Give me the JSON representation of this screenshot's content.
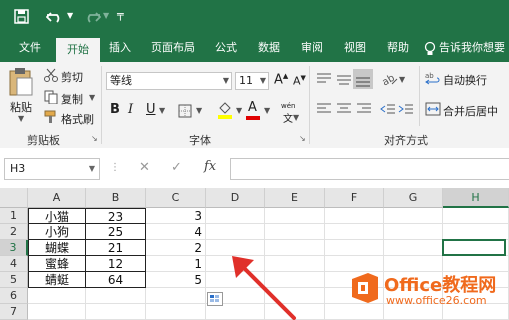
{
  "quick_access": {
    "tell_me": "告诉我你想要"
  },
  "tabs": [
    "文件",
    "开始",
    "插入",
    "页面布局",
    "公式",
    "数据",
    "审阅",
    "视图",
    "帮助"
  ],
  "active_tab": "开始",
  "ribbon": {
    "paste": "粘贴",
    "cut": "剪切",
    "copy": "复制",
    "format_painter": "格式刷",
    "clipboard_group": "剪贴板",
    "font_name": "等线",
    "font_size": "11",
    "font_group": "字体",
    "bold": "B",
    "italic": "I",
    "underline": "U",
    "wrap_text": "自动换行",
    "merge_center": "合并后居中",
    "alignment_group": "对齐方式",
    "grow_font": "A",
    "shrink_font": "A",
    "font_color_letter": "A",
    "phonetic": "wén"
  },
  "formula_bar": {
    "name_box": "H3",
    "fx": "fx",
    "cancel": "✕",
    "enter": "✓",
    "value": ""
  },
  "columns": [
    "A",
    "B",
    "C",
    "D",
    "E",
    "F",
    "G",
    "H"
  ],
  "rows": [
    {
      "num": "1",
      "a": "小猫",
      "b": "23",
      "c": "3"
    },
    {
      "num": "2",
      "a": "小狗",
      "b": "25",
      "c": "4"
    },
    {
      "num": "3",
      "a": "蝴蝶",
      "b": "21",
      "c": "2"
    },
    {
      "num": "4",
      "a": "蜜蜂",
      "b": "12",
      "c": "1"
    },
    {
      "num": "5",
      "a": "蜻蜓",
      "b": "64",
      "c": "5"
    },
    {
      "num": "6",
      "a": "",
      "b": "",
      "c": ""
    },
    {
      "num": "7",
      "a": "",
      "b": "",
      "c": ""
    }
  ],
  "watermark": {
    "brand": "Office教程网",
    "url": "www.office26.com"
  },
  "colors": {
    "excel_green": "#217346",
    "ribbon_bg": "#f3f3f3",
    "arrow_red": "#e0302a",
    "watermark_orange": "#f06a1d"
  }
}
